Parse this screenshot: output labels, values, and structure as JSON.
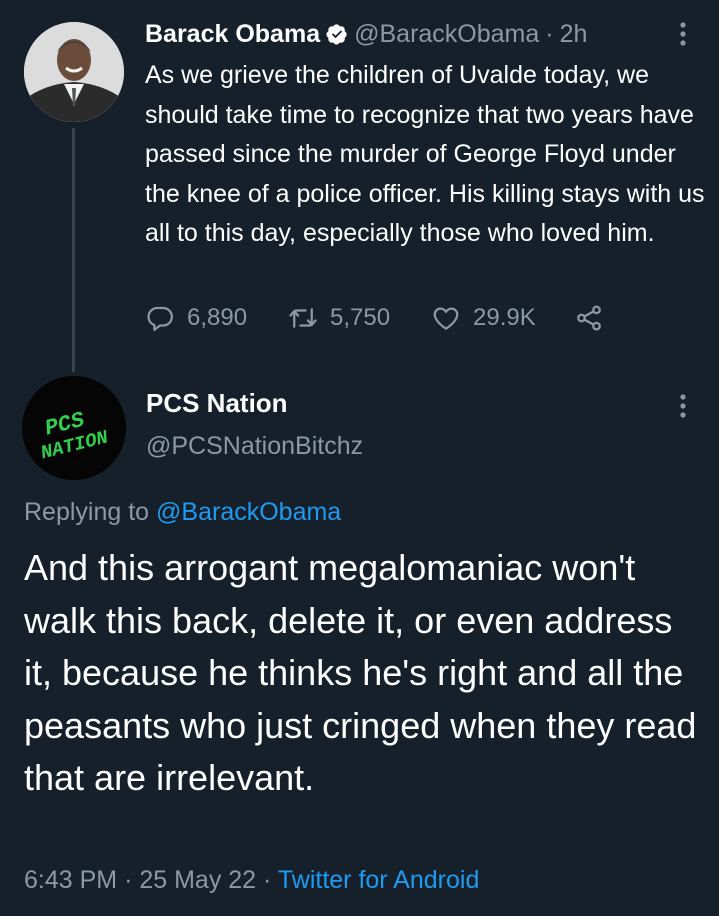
{
  "parent_tweet": {
    "author_name": "Barack Obama",
    "verified": true,
    "handle": "@BarackObama",
    "separator": "·",
    "time": "2h",
    "text": "As we grieve the children of Uvalde today, we should take time to recognize that two years have passed since the murder of George Floyd under the knee of a police officer. His killing stays with us all to this day, especially those who loved him.",
    "replies": "6,890",
    "retweets": "5,750",
    "likes": "29.9K",
    "icons": [
      "reply-icon",
      "retweet-icon",
      "like-icon",
      "share-icon",
      "more-icon",
      "verified-icon"
    ]
  },
  "reply_tweet": {
    "author_name": "PCS Nation",
    "handle": "@PCSNationBitchz",
    "avatar_text": [
      "PCS",
      "NATION"
    ],
    "replying_prefix": "Replying to",
    "replying_to": "@BarackObama",
    "text": "And this arrogant megalomaniac won't walk this back, delete it, or even address it, because he thinks he's right and all the peasants who just cringed when they read that are irrelevant.",
    "time": "6:43 PM",
    "date": "25 May 22",
    "separator": "·",
    "source": "Twitter for Android"
  },
  "colors": {
    "background": "#15202b",
    "muted_text": "#8b98a5",
    "link": "#1d9bf0",
    "avatar_text": "#2fd14c"
  }
}
